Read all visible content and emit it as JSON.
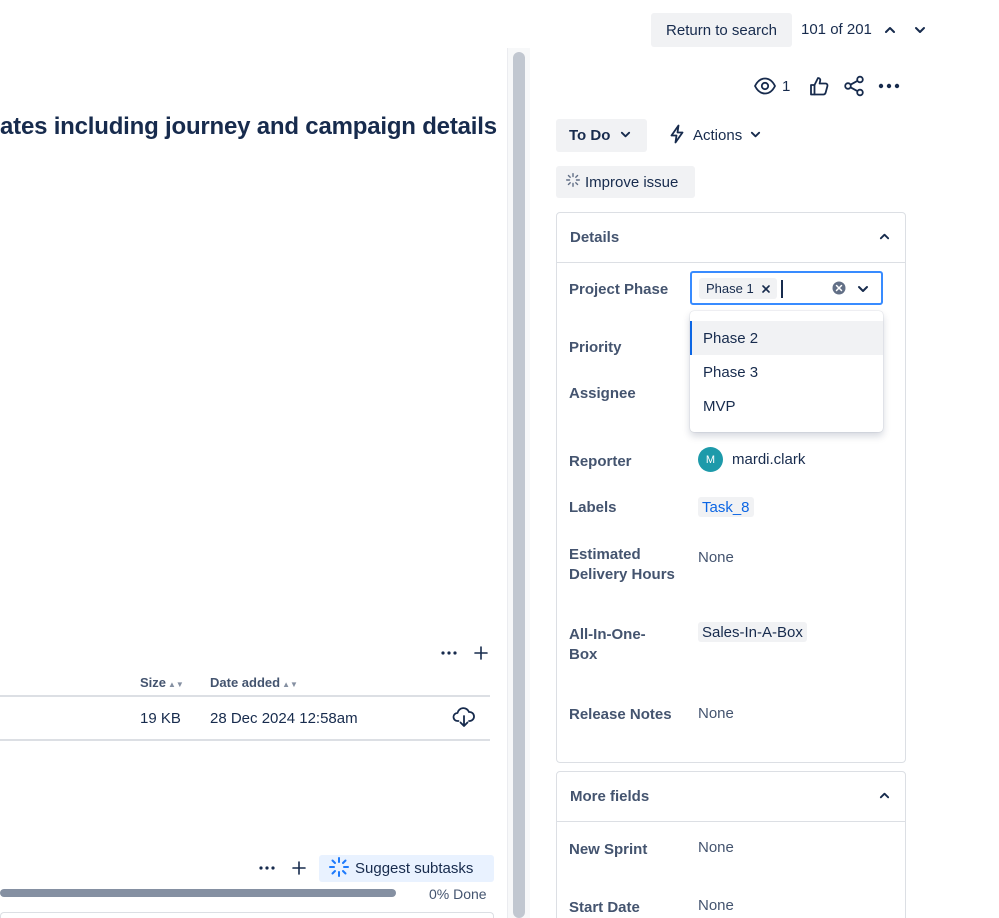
{
  "top_nav": {
    "return_label": "Return to search",
    "pager_text": "101 of 201"
  },
  "issue": {
    "title": "ates including journey and campaign details"
  },
  "attachments": {
    "columns": [
      "Size",
      "Date added"
    ],
    "rows": [
      {
        "size": "19 KB",
        "date": "28 Dec 2024 12:58am"
      }
    ]
  },
  "subtasks": {
    "suggest_label": "Suggest subtasks",
    "progress_label": "0% Done",
    "progress_percent": 0
  },
  "toolbar": {
    "watch_count": "1"
  },
  "status": {
    "label": "To Do"
  },
  "actions": {
    "label": "Actions"
  },
  "improve": {
    "label": "Improve issue"
  },
  "details": {
    "header": "Details",
    "project_phase": {
      "label": "Project Phase",
      "selected_chip": "Phase 1",
      "options": [
        "Phase 2",
        "Phase 3",
        "MVP"
      ]
    },
    "priority_label": "Priority",
    "assignee_label": "Assignee",
    "reporter": {
      "label": "Reporter",
      "initial": "M",
      "name": "mardi.clark"
    },
    "labels": {
      "label": "Labels",
      "value": "Task_8"
    },
    "estimated": {
      "label": "Estimated Delivery Hours",
      "value": "None"
    },
    "all_in_one": {
      "label": "All-In-One-Box",
      "value": "Sales-In-A-Box"
    },
    "release_notes": {
      "label": "Release Notes",
      "value": "None"
    }
  },
  "more_fields": {
    "header": "More fields",
    "new_sprint": {
      "label": "New Sprint",
      "value": "None"
    },
    "start_date": {
      "label": "Start Date",
      "value": "None"
    }
  },
  "colors": {
    "accent": "#0c66e4",
    "focus_border": "#388bff",
    "avatar": "#1d9aaa"
  }
}
